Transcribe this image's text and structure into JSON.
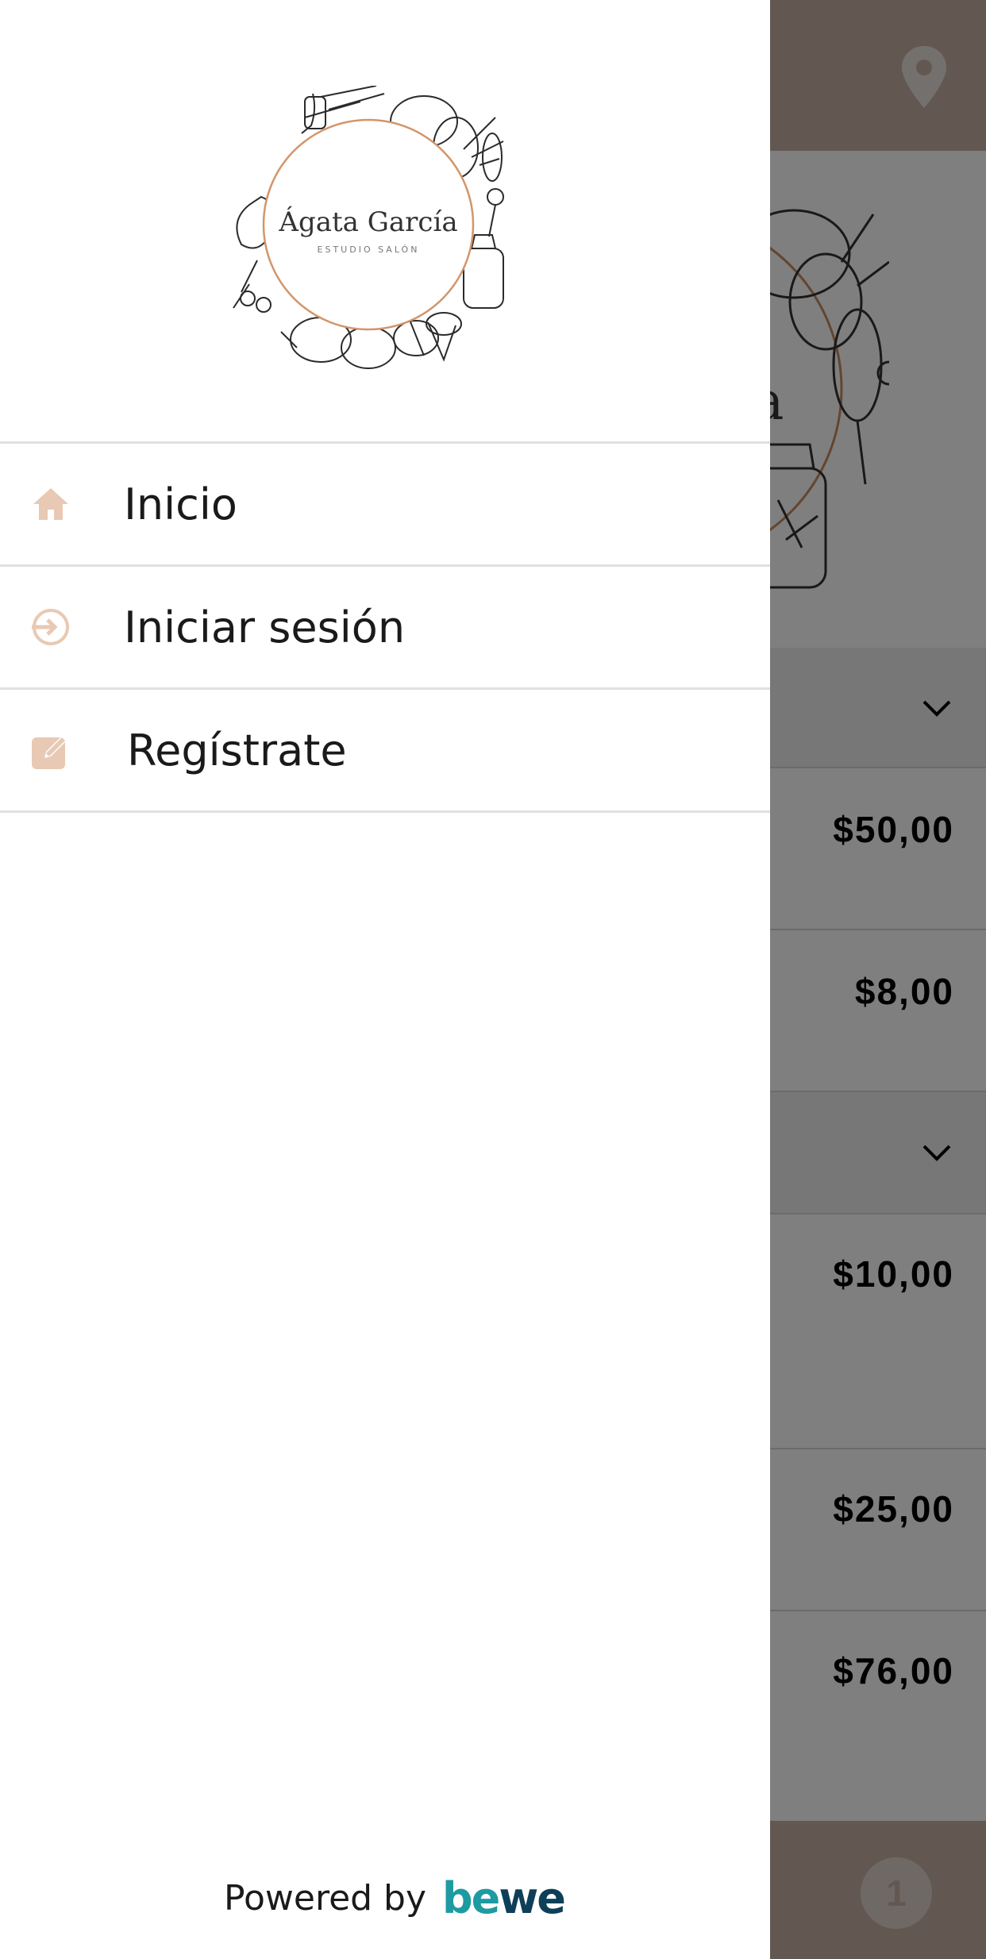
{
  "app": {
    "brand_name": "Ágata García",
    "brand_subtitle": "ESTUDIO SALÓN"
  },
  "background": {
    "hero_brand_fragment": "cía",
    "rows": [
      {
        "kind": "category"
      },
      {
        "kind": "service",
        "price": "$50,00"
      },
      {
        "kind": "service",
        "price": "$8,00"
      },
      {
        "kind": "category"
      },
      {
        "kind": "service",
        "price": "$10,00"
      },
      {
        "kind": "service",
        "price": "$25,00"
      },
      {
        "kind": "service",
        "price": "$76,00"
      }
    ],
    "cart_count": "1"
  },
  "drawer": {
    "menu": [
      {
        "label": "Inicio",
        "icon": "home-icon"
      },
      {
        "label": "Iniciar sesión",
        "icon": "sign-in-icon"
      },
      {
        "label": "Regístrate",
        "icon": "edit-icon"
      }
    ],
    "powered_by": "Powered by",
    "powered_brand_a": "be",
    "powered_brand_b": "we"
  },
  "colors": {
    "accent": "#c7b1a3",
    "icon_tint": "#e8c9b4",
    "bewe_teal": "#1e9aa2",
    "bewe_navy": "#0e3f59"
  }
}
